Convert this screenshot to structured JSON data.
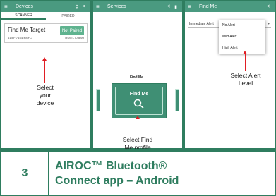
{
  "panel1": {
    "appbar_title": "Devices",
    "tabs": [
      "SCANNER",
      "PAIRED"
    ],
    "device": {
      "name": "Find Me Target",
      "button": "Not Paired",
      "address": "61:BF:74:51:F8:FC",
      "rssi": "RSSI: -70 dBm"
    }
  },
  "panel2": {
    "appbar_title": "Services",
    "profile_label": "Find Me",
    "tile_text": "Find Me"
  },
  "panel3": {
    "appbar_title": "Find Me",
    "select_value": "Immediate Alert",
    "options": [
      "No Alert",
      "Mild Alert",
      "High Alert"
    ]
  },
  "notes": {
    "select_device": "Select\nyour\ndevice",
    "select_profile": "Select Find\nMe profile",
    "select_level": "Select Alert\nLevel"
  },
  "footer": {
    "step_number": "3",
    "title": "AIROC™ Bluetooth®\nConnect app – Android"
  },
  "colors": {
    "brand_green": "#2f7d5f",
    "appbar_green": "#4a9a80",
    "arrow_red": "#e01e24"
  }
}
